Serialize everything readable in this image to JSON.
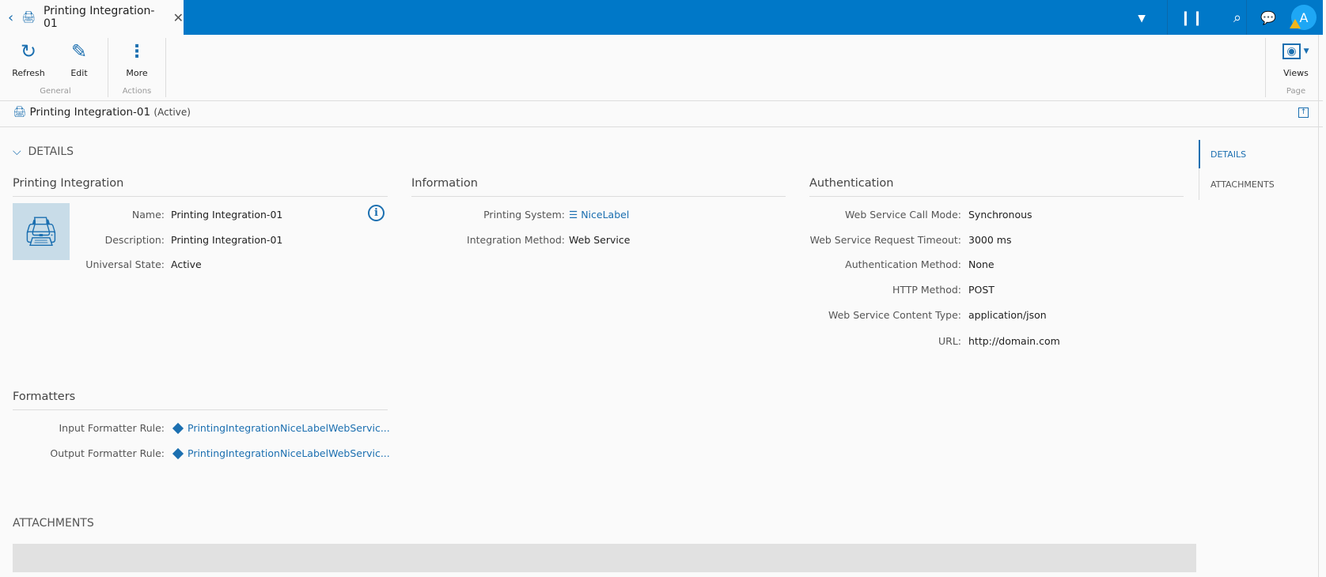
{
  "tab": {
    "title": "Printing Integration-01"
  },
  "header": {
    "avatar": "A",
    "icons": [
      "dropdown-icon",
      "barcode-icon",
      "search-icon",
      "chat-icon",
      "warning-icon"
    ]
  },
  "ribbon": {
    "refresh": "Refresh",
    "edit": "Edit",
    "more": "More",
    "views": "Views",
    "groups": {
      "general": "General",
      "actions": "Actions",
      "page": "Page"
    }
  },
  "titlebar": {
    "name": "Printing Integration-01",
    "state": "(Active)"
  },
  "details": {
    "heading": "DETAILS",
    "printing_integration": {
      "title": "Printing Integration",
      "rows": [
        {
          "label": "Name:",
          "value": "Printing Integration-01"
        },
        {
          "label": "Description:",
          "value": "Printing Integration-01"
        },
        {
          "label": "Universal State:",
          "value": "Active"
        }
      ]
    },
    "information": {
      "title": "Information",
      "rows": [
        {
          "label": "Printing System:",
          "value": "NiceLabel"
        },
        {
          "label": "Integration Method:",
          "value": "Web Service"
        }
      ]
    },
    "authentication": {
      "title": "Authentication",
      "rows": [
        {
          "label": "Web Service Call Mode:",
          "value": "Synchronous"
        },
        {
          "label": "Web Service Request Timeout:",
          "value": "3000 ms"
        },
        {
          "label": "Authentication Method:",
          "value": "None"
        },
        {
          "label": "HTTP Method:",
          "value": "POST"
        },
        {
          "label": "Web Service Content Type:",
          "value": "application/json"
        },
        {
          "label": "URL:",
          "value": "http://domain.com"
        }
      ]
    },
    "formatters": {
      "title": "Formatters",
      "rows": [
        {
          "label": "Input Formatter Rule:",
          "value": "PrintingIntegrationNiceLabelWebServic..."
        },
        {
          "label": "Output Formatter Rule:",
          "value": "PrintingIntegrationNiceLabelWebServic..."
        }
      ]
    }
  },
  "attachments": {
    "heading": "ATTACHMENTS"
  },
  "sidenav": {
    "items": [
      "DETAILS",
      "ATTACHMENTS"
    ]
  },
  "colors": {
    "brand": "#0078c8",
    "accent": "#1b6fb0"
  }
}
